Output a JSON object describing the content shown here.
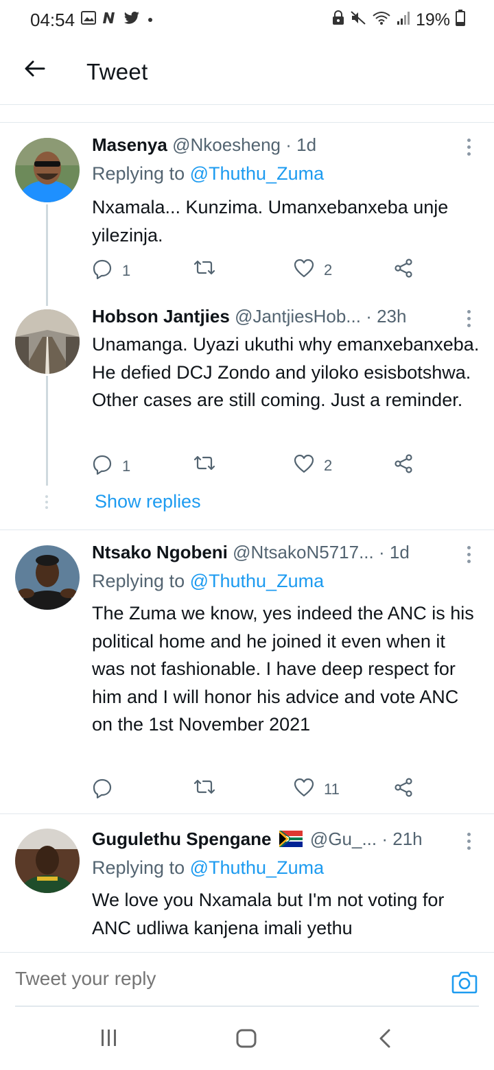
{
  "status_bar": {
    "time": "04:54",
    "battery": "19%",
    "icons": [
      "gallery-icon",
      "n-icon",
      "twitter-bird-icon",
      "dot-icon",
      "lock-icon",
      "mute-icon",
      "wifi-icon",
      "signal-icon",
      "battery-icon"
    ]
  },
  "header": {
    "title": "Tweet",
    "back_icon": "arrow-left-icon"
  },
  "tweets": [
    {
      "name": "Masenya",
      "handle": "@Nkoesheng",
      "time": "· 1d",
      "replying_prefix": "Replying to ",
      "replying_to": "@Thuthu_Zuma",
      "text": "Nxamala... Kunzima. Umanxebanxeba unje yilezinja.",
      "replies": "1",
      "retweets": "",
      "likes": "2"
    },
    {
      "name": "Hobson Jantjies",
      "handle": "@JantjiesHob...",
      "time": "· 23h",
      "text": "Unamanga. Uyazi ukuthi why emanxebanxeba. He defied DCJ Zondo and yiloko esisbotshwa. Other cases are still coming. Just a reminder.",
      "replies": "1",
      "retweets": "",
      "likes": "2",
      "show_replies": "Show replies"
    },
    {
      "name": "Ntsako Ngobeni",
      "handle": "@NtsakoN5717...",
      "time": "· 1d",
      "replying_prefix": "Replying to ",
      "replying_to": "@Thuthu_Zuma",
      "text": "The Zuma we know, yes indeed the ANC is his political home and he joined it even when it was not fashionable. I have deep respect for him and I will honor his advice and vote ANC on the 1st November 2021",
      "replies": "",
      "retweets": "",
      "likes": "11"
    },
    {
      "name": "Gugulethu Spengane",
      "flag": "south-africa-flag-icon",
      "handle": "@Gu_...",
      "time": "· 21h",
      "replying_prefix": "Replying to ",
      "replying_to": "@Thuthu_Zuma",
      "text": "We love you Nxamala but I'm not voting for ANC udliwa kanjena imali yethu"
    }
  ],
  "reply_box": {
    "placeholder": "Tweet your reply",
    "camera_icon": "camera-icon"
  },
  "nav": {
    "recents_icon": "recents-icon",
    "home_icon": "home-icon",
    "back_icon": "back-chevron-icon"
  },
  "colors": {
    "accent": "#1d9bf0",
    "text": "#0f1419",
    "muted": "#536471",
    "divider": "#e1e8ed"
  }
}
